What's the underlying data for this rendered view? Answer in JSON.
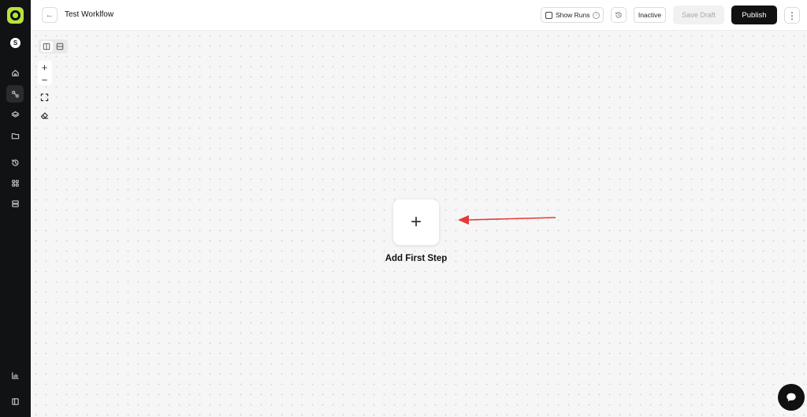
{
  "sidebar": {
    "avatar_initial": "S",
    "items": [
      {
        "icon": "home-icon"
      },
      {
        "icon": "workflow-icon",
        "active": true
      },
      {
        "icon": "layers-icon"
      },
      {
        "icon": "folder-icon"
      },
      {
        "icon": "history-icon"
      },
      {
        "icon": "apps-icon"
      },
      {
        "icon": "server-icon"
      },
      {
        "icon": "analytics-icon"
      },
      {
        "icon": "panel-icon"
      }
    ]
  },
  "header": {
    "title": "Test Worklfow",
    "show_runs_label": "Show Runs",
    "show_runs_checked": false,
    "status_label": "Inactive",
    "save_draft_label": "Save Draft",
    "publish_label": "Publish"
  },
  "canvas": {
    "add_step_symbol": "+",
    "add_step_label": "Add First Step",
    "zoom_in_symbol": "+",
    "zoom_out_symbol": "−"
  },
  "colors": {
    "brand": "#b5e63c",
    "annotation_arrow": "#e53935",
    "primary_button": "#111111"
  }
}
